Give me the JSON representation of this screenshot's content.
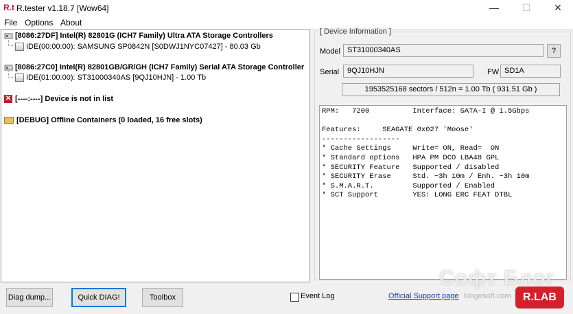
{
  "window": {
    "logo": "R.t",
    "title": "R.tester v1.18.7 [Wow64]",
    "minimize_glyph": "—",
    "maximize_glyph": "☐",
    "close_glyph": "✕"
  },
  "menu": [
    {
      "label": "File"
    },
    {
      "label": "Options"
    },
    {
      "label": "About"
    }
  ],
  "tree": {
    "controller1": "[8086:27DF] Intel(R) 82801G (ICH7 Family) Ultra ATA Storage Controllers",
    "device1": "IDE(00:00:00): SAMSUNG SP0842N [S0DWJ1NYC07427]  - 80.03 Gb",
    "controller2": "[8086:27C0] Intel(R) 82801GB/GR/GH (ICH7 Family) Serial ATA Storage Controller",
    "device2": "IDE(01:00:00): ST31000340AS [9QJ10HJN]  - 1.00 Tb",
    "notinlist": "[----:----] Device is not in list",
    "offline": "[DEBUG] Offline Containers (0 loaded, 16 free slots)"
  },
  "device_info": {
    "legend": "[ Device Information ]",
    "model_label": "Model",
    "model_value": "ST31000340AS",
    "help_label": "?",
    "serial_label": "Serial",
    "serial_value": "9QJ10HJN",
    "fw_label": "FW",
    "fw_value": "SD1A",
    "capacity": "1953525168 sectors / 512n = 1.00 Tb ( 931.51 Gb )",
    "details": "RPM:   7200          Interface: SATA-I @ 1.5Gbps\n\nFeatures:     SEAGATE 0x027 'Moose'\n------------------\n* Cache Settings     Write= ON, Read=  ON\n* Standard options   HPA PM DCO LBA48 GPL\n* SECURITY Feature   Supported / disabled\n* SECURITY Erase     Std. ~3h 10m / Enh. ~3h 10m\n* S.M.A.R.T.         Supported / Enabled\n* SCT Support        YES: LONG ERC FEAT DTBL"
  },
  "bottom": {
    "diag_dump": "Diag dump...",
    "quick_diag": "Quick DIAG!",
    "toolbox": "Toolbox",
    "event_log": "Event Log",
    "support_link": "Official Support page",
    "brand": "R.LAB"
  },
  "watermark": {
    "text": "Софт Блог",
    "sub": "blogosoft.com"
  },
  "colors": {
    "accent": "#0078d7",
    "brand_red": "#d3202a",
    "link": "#0645ad"
  },
  "icons": {
    "controller": "controller-icon",
    "disk": "disk-icon",
    "error": "error-x-icon",
    "folder": "folder-icon"
  }
}
